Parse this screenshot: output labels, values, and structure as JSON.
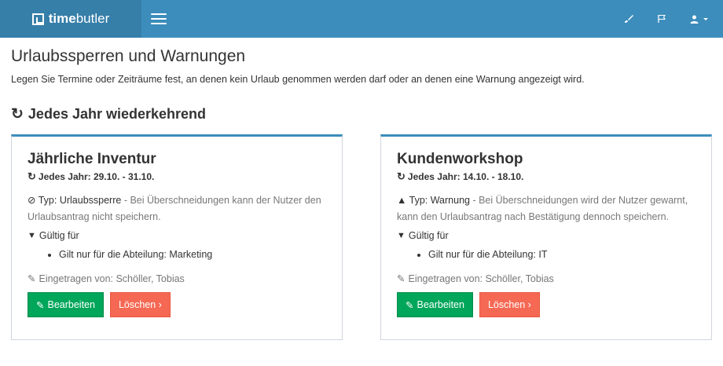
{
  "brand": {
    "bold": "time",
    "light": "butler"
  },
  "topbar": {
    "icons": [
      "brush-icon",
      "flag-icon",
      "user-icon"
    ]
  },
  "page": {
    "title": "Urlaubssperren und Warnungen",
    "description": "Legen Sie Termine oder Zeiträume fest, an denen kein Urlaub genommen werden darf oder an denen eine Warnung angezeigt wird."
  },
  "section": {
    "title": "Jedes Jahr wiederkehrend"
  },
  "cards": [
    {
      "title": "Jährliche Inventur",
      "recurrence": "Jedes Jahr: 29.10. - 31.10.",
      "type_label": "Typ: Urlaubssperre",
      "type_desc": " - Bei Überschneidungen kann der Nutzer den Urlaubsantrag nicht speichern.",
      "valid_label": "Gültig für",
      "scope": "Gilt nur für die Abteilung: Marketing",
      "creator": "Eingetragen von: Schöller, Tobias",
      "edit_label": "Bearbeiten",
      "delete_label": "Löschen ›"
    },
    {
      "title": "Kundenworkshop",
      "recurrence": "Jedes Jahr: 14.10. - 18.10.",
      "type_label": "Typ: Warnung",
      "type_desc": " - Bei Überschneidungen wird der Nutzer gewarnt, kann den Urlaubsantrag nach Bestätigung dennoch speichern.",
      "valid_label": "Gültig für",
      "scope": "Gilt nur für die Abteilung: IT",
      "creator": "Eingetragen von: Schöller, Tobias",
      "edit_label": "Bearbeiten",
      "delete_label": "Löschen ›"
    }
  ],
  "colors": {
    "topbar": "#3c8dbc",
    "brand_bg": "#367fa9",
    "edit": "#00a65a",
    "delete": "#f56954"
  }
}
